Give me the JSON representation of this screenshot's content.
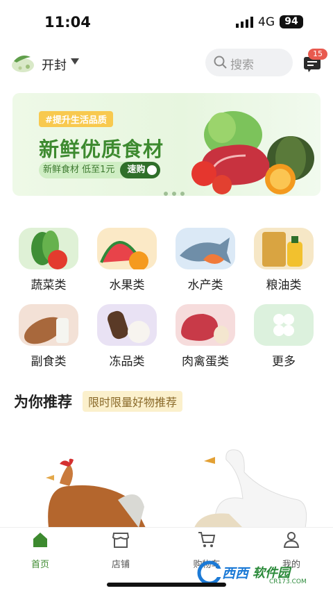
{
  "status": {
    "time": "11:04",
    "network": "4G",
    "battery": "94"
  },
  "header": {
    "city": "开封",
    "search_placeholder": "搜索",
    "message_badge": "15"
  },
  "banner": {
    "tag": "#提升生活品质",
    "headline": "新鲜优质食材",
    "sub": "新鲜食材  低至1元",
    "button": "速购"
  },
  "categories": [
    {
      "label": "蔬菜类",
      "icon": "vegetable-icon"
    },
    {
      "label": "水果类",
      "icon": "fruit-icon"
    },
    {
      "label": "水产类",
      "icon": "seafood-icon"
    },
    {
      "label": "粮油类",
      "icon": "grain-oil-icon"
    },
    {
      "label": "副食类",
      "icon": "bread-icon"
    },
    {
      "label": "冻品类",
      "icon": "frozen-icon"
    },
    {
      "label": "肉禽蛋类",
      "icon": "meat-icon"
    },
    {
      "label": "更多",
      "icon": "more-grid-icon"
    }
  ],
  "section": {
    "title": "为你推荐",
    "tag": "限时限量好物推荐"
  },
  "tabbar": [
    {
      "label": "首页",
      "icon": "home-icon",
      "active": true
    },
    {
      "label": "店铺",
      "icon": "shop-icon",
      "active": false
    },
    {
      "label": "购物车",
      "icon": "cart-icon",
      "active": false
    },
    {
      "label": "我的",
      "icon": "user-icon",
      "active": false
    }
  ],
  "watermark": {
    "text1": "西西",
    "text2": "软件园",
    "text3": "CR173.COM"
  },
  "colors": {
    "brand_green": "#3d8a2f",
    "badge_red": "#e85a4f",
    "tag_yellow": "#f8c94f"
  }
}
